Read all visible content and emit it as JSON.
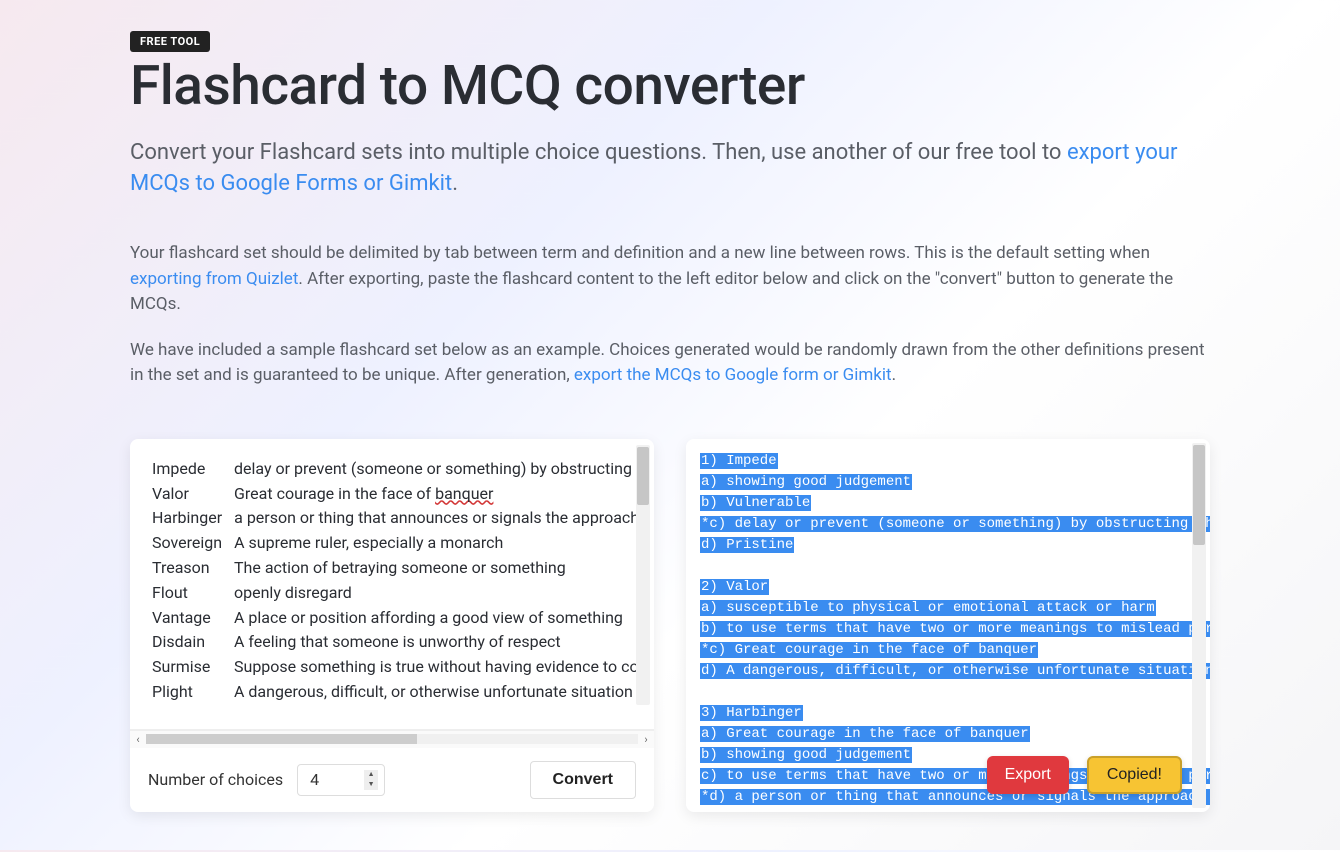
{
  "badge": "FREE TOOL",
  "title": "Flashcard to MCQ converter",
  "subtitle_pre": "Convert your Flashcard sets into multiple choice questions. Then, use another of our free tool to ",
  "subtitle_link": "export your MCQs to Google Forms or Gimkit",
  "subtitle_post": ".",
  "para1_pre": "Your flashcard set should be delimited by tab between term and definition and a new line between rows. This is the default setting when ",
  "para1_link": "exporting from Quizlet",
  "para1_post": ". After exporting, paste the flashcard content to the left editor below and click on the \"convert\" button to generate the MCQs.",
  "para2_pre": "We have included a sample flashcard set below as an example. Choices generated would be randomly drawn from the other definitions present in the set and is guaranteed to be unique. After generation, ",
  "para2_link": "export the MCQs to Google form or Gimkit",
  "para2_post": ".",
  "flashcards": [
    {
      "term": "Impede",
      "def": "delay or prevent (someone or something) by obstructing"
    },
    {
      "term": "Valor",
      "def_pre": "Great courage in the face of ",
      "def_squiggle": "banquer"
    },
    {
      "term": "Harbinger",
      "def": "a person or thing that announces or signals the approach"
    },
    {
      "term": "Sovereign",
      "def": "A supreme ruler, especially a monarch"
    },
    {
      "term": "Treason",
      "def": "The action of betraying someone or something"
    },
    {
      "term": "Flout",
      "def": "openly disregard"
    },
    {
      "term": "Vantage",
      "def": "A place or position affording a good view of something"
    },
    {
      "term": "Disdain",
      "def": "A feeling that someone is unworthy of respect"
    },
    {
      "term": "Surmise",
      "def": "Suppose something is true without having evidence to co"
    },
    {
      "term": "Plight",
      "def": "A dangerous, difficult, or otherwise unfortunate situation"
    }
  ],
  "controls": {
    "label": "Number of choices",
    "value": "4",
    "convert": "Convert"
  },
  "output_lines": [
    "1) Impede",
    "a) showing good judgement",
    "b) Vulnerable",
    "*c) delay or prevent (someone or something) by obstructing th",
    "d) Pristine",
    "",
    "2) Valor",
    "a) susceptible to physical or emotional attack or harm",
    "b) to use terms that have two or more meanings to mislead pur",
    "*c) Great courage in the face of banquer",
    "d) A dangerous, difficult, or otherwise unfortunate situation",
    "",
    "3) Harbinger",
    "a) Great courage in the face of banquer",
    "b) showing good judgement",
    "c) to use terms that have two or more meanings to mislead pur",
    "*d) a person or thing that announces or signals the approach "
  ],
  "buttons": {
    "export": "Export",
    "copied": "Copied!"
  },
  "scroll_chars": {
    "left": "‹",
    "right": "›"
  }
}
